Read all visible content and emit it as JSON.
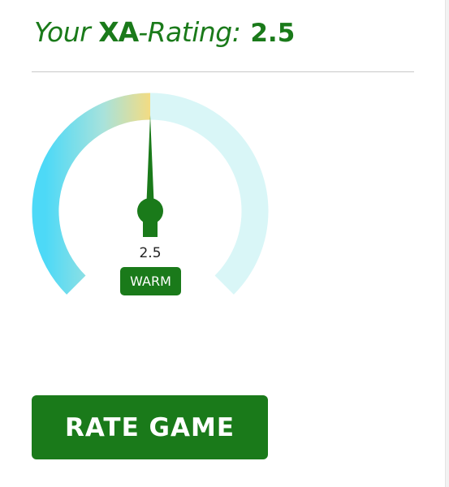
{
  "header": {
    "title_prefix": "Your",
    "title_xa": "XA",
    "title_rest": "-Rating:",
    "rating_value": "2.5"
  },
  "gauge": {
    "value": 2.5,
    "value_text": "2.5",
    "label": "WARM",
    "needle_fraction": 0.5
  },
  "actions": {
    "rate_label": "RATE GAME"
  },
  "colors": {
    "brand_green": "#1a7a1a",
    "gauge_cold": "#4dd9f7",
    "gauge_warm": "#f3dc83",
    "gauge_track": "#d9f6f7"
  }
}
